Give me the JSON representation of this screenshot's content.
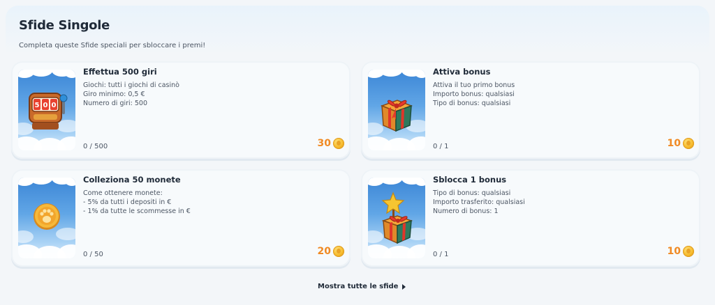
{
  "section": {
    "title": "Sfide Singole",
    "subtitle": "Completa queste Sfide speciali per sbloccare i premi!"
  },
  "challenges": [
    {
      "title": "Effettua 500 giri",
      "details": [
        "Giochi: tutti i giochi di casinò",
        "Giro minimo: 0,5 €",
        "Numero di giri: 500"
      ],
      "progress": "0 / 500",
      "reward": "30",
      "icon": "slot-machine-icon"
    },
    {
      "title": "Attiva bonus",
      "details": [
        "Attiva il tuo primo bonus",
        "Importo bonus: qualsiasi",
        "Tipo di bonus: qualsiasi"
      ],
      "progress": "0 / 1",
      "reward": "10",
      "icon": "gift-box-icon"
    },
    {
      "title": "Colleziona 50 monete",
      "details": [
        "Come ottenere monete:",
        "- 5% da tutti i depositi in €",
        "- 1% da tutte le scommesse in €"
      ],
      "progress": "0 / 50",
      "reward": "20",
      "icon": "paw-coin-icon"
    },
    {
      "title": "Sblocca 1 bonus",
      "details": [
        "Tipo di bonus: qualsiasi",
        "Importo trasferito: qualsiasi",
        "Numero di bonus: 1"
      ],
      "progress": "0 / 1",
      "reward": "10",
      "icon": "star-gift-icon"
    }
  ],
  "footer": {
    "show_all_label": "Mostra tutte le sfide"
  },
  "colors": {
    "accent_orange": "#f08a24",
    "coin_gold": "#f5b92a",
    "text_dark": "#1f2a38"
  }
}
